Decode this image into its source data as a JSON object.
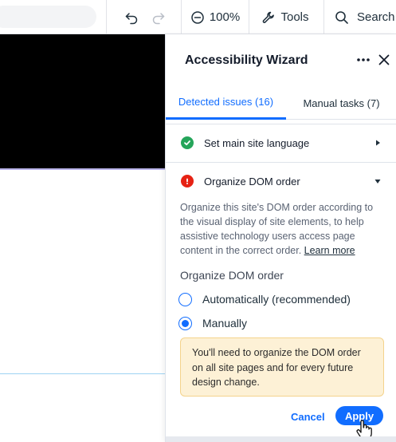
{
  "toolbar": {
    "zoom_label": "100%",
    "tools_label": "Tools",
    "search_label": "Search"
  },
  "panel": {
    "title": "Accessibility Wizard",
    "tabs": [
      {
        "label": "Detected issues (16)",
        "active": true
      },
      {
        "label": "Manual tasks (7)",
        "active": false
      }
    ],
    "issues": [
      {
        "label": "Set main site language",
        "status": "passed",
        "expanded": false
      },
      {
        "label": "Organize DOM order",
        "status": "error",
        "expanded": true
      }
    ],
    "description": "Organize this site's DOM order according to the visual display of site elements, to help assistive technology users access page content in the correct order.",
    "learn_more": "Learn more",
    "section_title": "Organize DOM order",
    "options": [
      {
        "label": "Automatically (recommended)",
        "selected": false
      },
      {
        "label": "Manually",
        "selected": true
      }
    ],
    "notice": "You'll need to organize the DOM order on all site pages and for every future design change.",
    "cancel_label": "Cancel",
    "apply_label": "Apply"
  },
  "colors": {
    "accent": "#116dff",
    "success": "#25a55a",
    "error": "#e62214",
    "notice_bg": "#fdf1d6",
    "notice_border": "#f4d38c"
  },
  "icons": [
    "undo-icon",
    "redo-icon",
    "zoom-out-icon",
    "tools-icon",
    "search-icon",
    "more-icon",
    "close-icon",
    "check-circle-icon",
    "error-circle-icon",
    "chevron-right-icon",
    "chevron-down-icon",
    "hand-cursor-icon"
  ]
}
